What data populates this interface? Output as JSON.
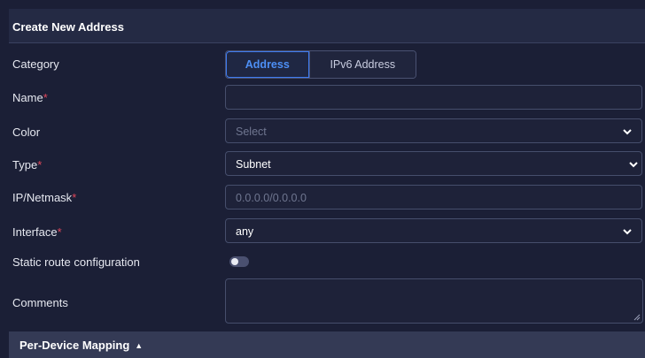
{
  "header": {
    "title": "Create New Address"
  },
  "category": {
    "label": "Category",
    "options": [
      "Address",
      "IPv6 Address"
    ],
    "selected": "Address"
  },
  "name": {
    "label": "Name",
    "required_mark": "*",
    "value": ""
  },
  "color": {
    "label": "Color",
    "placeholder": "Select"
  },
  "type": {
    "label": "Type",
    "required_mark": "*",
    "value": "Subnet"
  },
  "ip_netmask": {
    "label": "IP/Netmask",
    "required_mark": "*",
    "placeholder": "0.0.0.0/0.0.0.0"
  },
  "interface": {
    "label": "Interface",
    "required_mark": "*",
    "value": "any"
  },
  "static_route": {
    "label": "Static route configuration",
    "enabled": false
  },
  "comments": {
    "label": "Comments",
    "value": ""
  },
  "per_device": {
    "label": "Per-Device Mapping",
    "icon": "caret-up-icon"
  },
  "colors": {
    "accent": "#3e7bf0",
    "required": "#e0475b",
    "background": "#1b1f36"
  }
}
